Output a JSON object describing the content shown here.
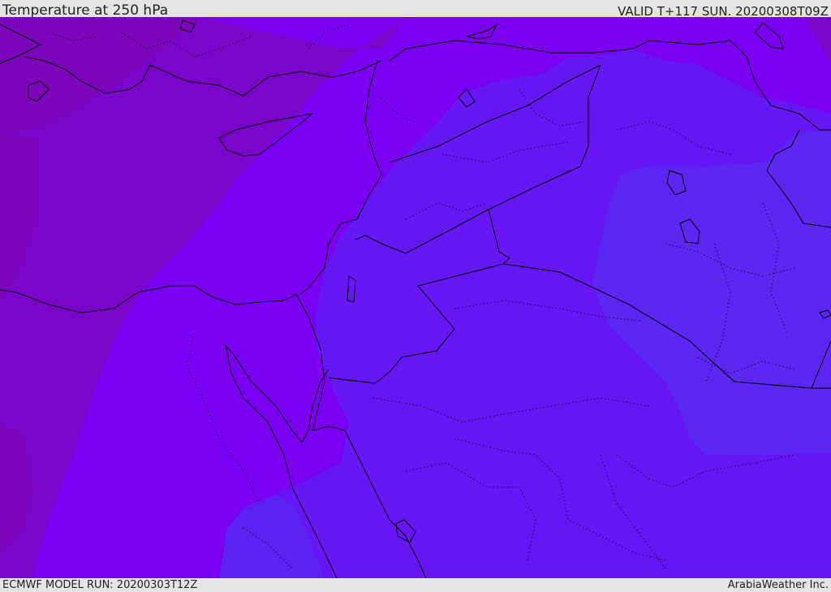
{
  "header": {
    "title": "Temperature at 250 hPa",
    "valid": "VALID T+117 SUN. 20200308T09Z"
  },
  "footer": {
    "model_run": "ECMWF MODEL RUN: 20200303T12Z",
    "brand": "ArabiaWeather Inc."
  },
  "map": {
    "region": "Eastern Mediterranean / Middle East",
    "colors": {
      "deep_purple": "#7a05c8",
      "purple": "#7b00f3",
      "violet": "#6716f5",
      "blue_violet": "#5b27f2",
      "coastline": "#000000"
    }
  }
}
